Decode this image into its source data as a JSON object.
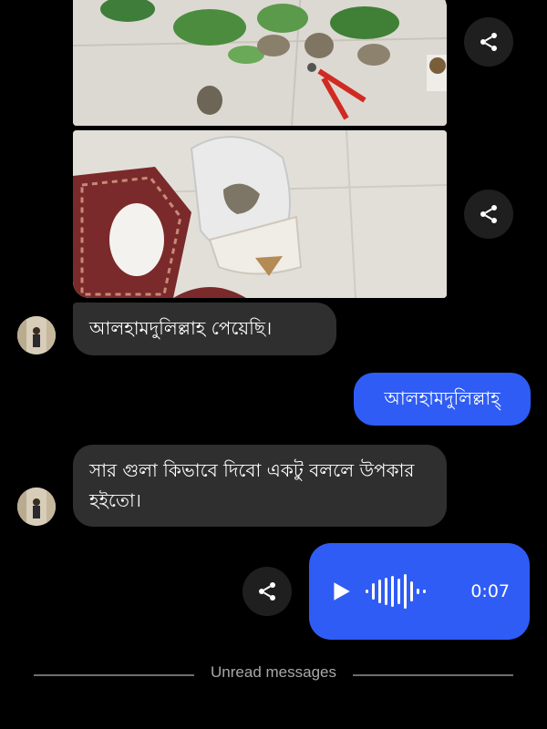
{
  "messages": {
    "incoming_1": "আলহামদুলিল্লাহ  পেয়েছি।",
    "outgoing_1": "আলহামদুলিল্লাহ্",
    "incoming_2": "সার গুলা কিভাবে দিবো একটু বললে উপকার হইতো।"
  },
  "voice_message": {
    "duration": "0:07"
  },
  "divider": {
    "label": "Unread messages"
  },
  "icons": {
    "share": "share-icon",
    "play": "play-icon",
    "waveform": "waveform-icon"
  },
  "colors": {
    "background": "#000000",
    "incoming_bubble": "#2f2f2f",
    "outgoing_bubble": "#2f5cf5",
    "share_button": "#1f1f1f"
  }
}
